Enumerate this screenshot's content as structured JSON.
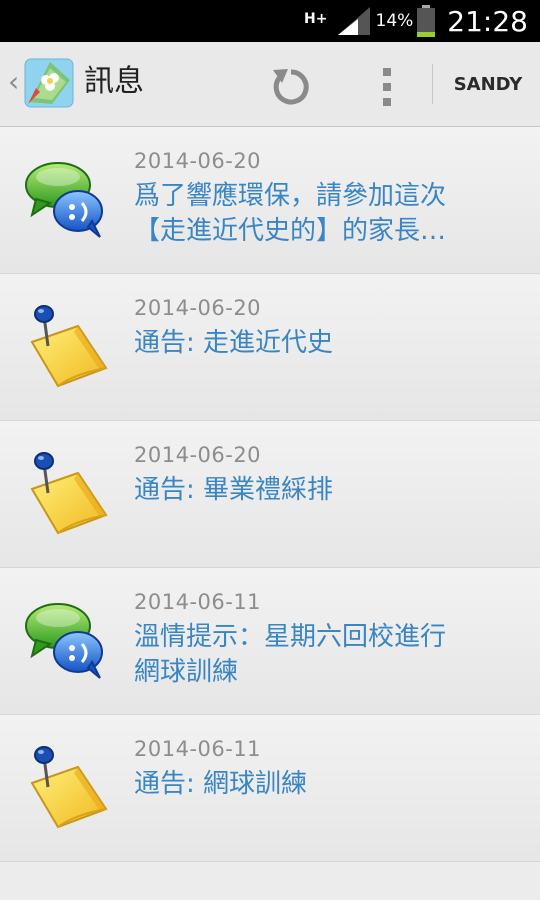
{
  "status_bar": {
    "network": "H+",
    "battery_percent": "14%",
    "time": "21:28",
    "icons": [
      "network-type-icon",
      "signal-icon",
      "battery-icon"
    ]
  },
  "action_bar": {
    "title": "訊息",
    "user_label": "SANDY",
    "icons": [
      "back-caret-icon",
      "app-logo-icon",
      "refresh-icon",
      "overflow-menu-icon"
    ]
  },
  "messages": [
    {
      "date": "2014-06-20",
      "text": "爲了響應環保，請參加這次\n【走進近代史的】的家長…",
      "icon": "chat-bubbles-icon"
    },
    {
      "date": "2014-06-20",
      "text": "通告: 走進近代史",
      "icon": "sticky-note-pin-icon"
    },
    {
      "date": "2014-06-20",
      "text": "通告: 畢業禮綵排",
      "icon": "sticky-note-pin-icon"
    },
    {
      "date": "2014-06-11",
      "text": "溫情提示：星期六回校進行\n網球訓練",
      "icon": "chat-bubbles-icon"
    },
    {
      "date": "2014-06-11",
      "text": "通告: 網球訓練",
      "icon": "sticky-note-pin-icon"
    }
  ],
  "colors": {
    "status_bar_bg": "#000000",
    "action_bar_bg": "#e9e9e9",
    "message_text": "#3a86c4",
    "date_text": "#8d8d8d"
  }
}
